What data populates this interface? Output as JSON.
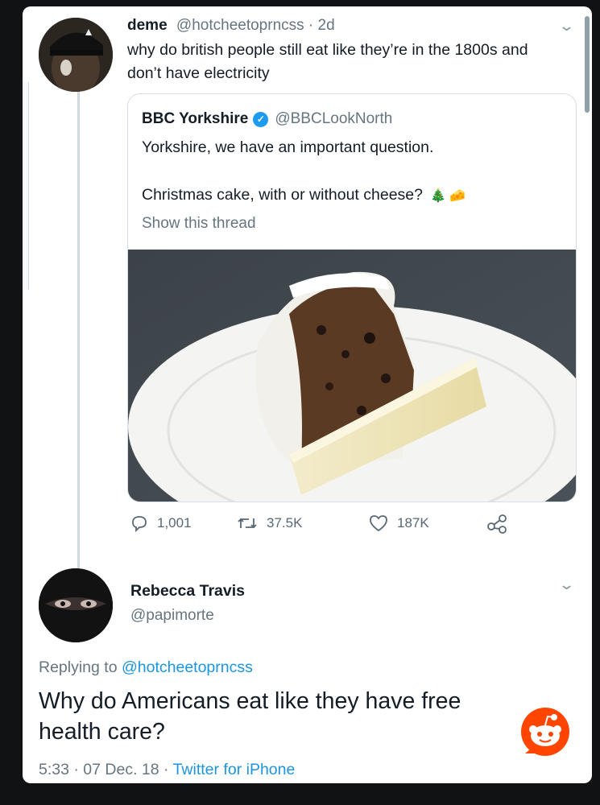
{
  "tweet": {
    "display_name": "deme",
    "handle": "@hotcheetoprncss",
    "separator": " · ",
    "age": "2d",
    "text": "why do british people still eat like they’re in the 1800s and don’t have electricity",
    "quoted": {
      "display_name": "BBC Yorkshire",
      "handle": "@BBCLookNorth",
      "line1": "Yorkshire, we have an important question.",
      "line2": "Christmas cake, with or without cheese?",
      "emoji1": "🎄",
      "emoji2": "🧀",
      "show_thread": "Show this thread"
    },
    "stats": {
      "replies": "1,001",
      "retweets": "37.5K",
      "likes": "187K"
    }
  },
  "reply": {
    "display_name": "Rebecca Travis",
    "handle": "@papimorte",
    "replying_prefix": "Replying to ",
    "replying_handle": "@hotcheetoprncss",
    "text": "Why do Americans eat like they have free health care?",
    "time": "5:33",
    "dot1": " · ",
    "date": "07 Dec. 18",
    "dot2": " · ",
    "client": "Twitter for iPhone"
  },
  "colors": {
    "accent": "#1b95e0",
    "muted": "#66757f",
    "text": "#141d26",
    "reddit": "#ff4500"
  },
  "icons": [
    "chevron-down-icon",
    "verified-badge-icon",
    "reply-icon",
    "retweet-icon",
    "like-icon",
    "share-icon",
    "reddit-logo-icon"
  ]
}
